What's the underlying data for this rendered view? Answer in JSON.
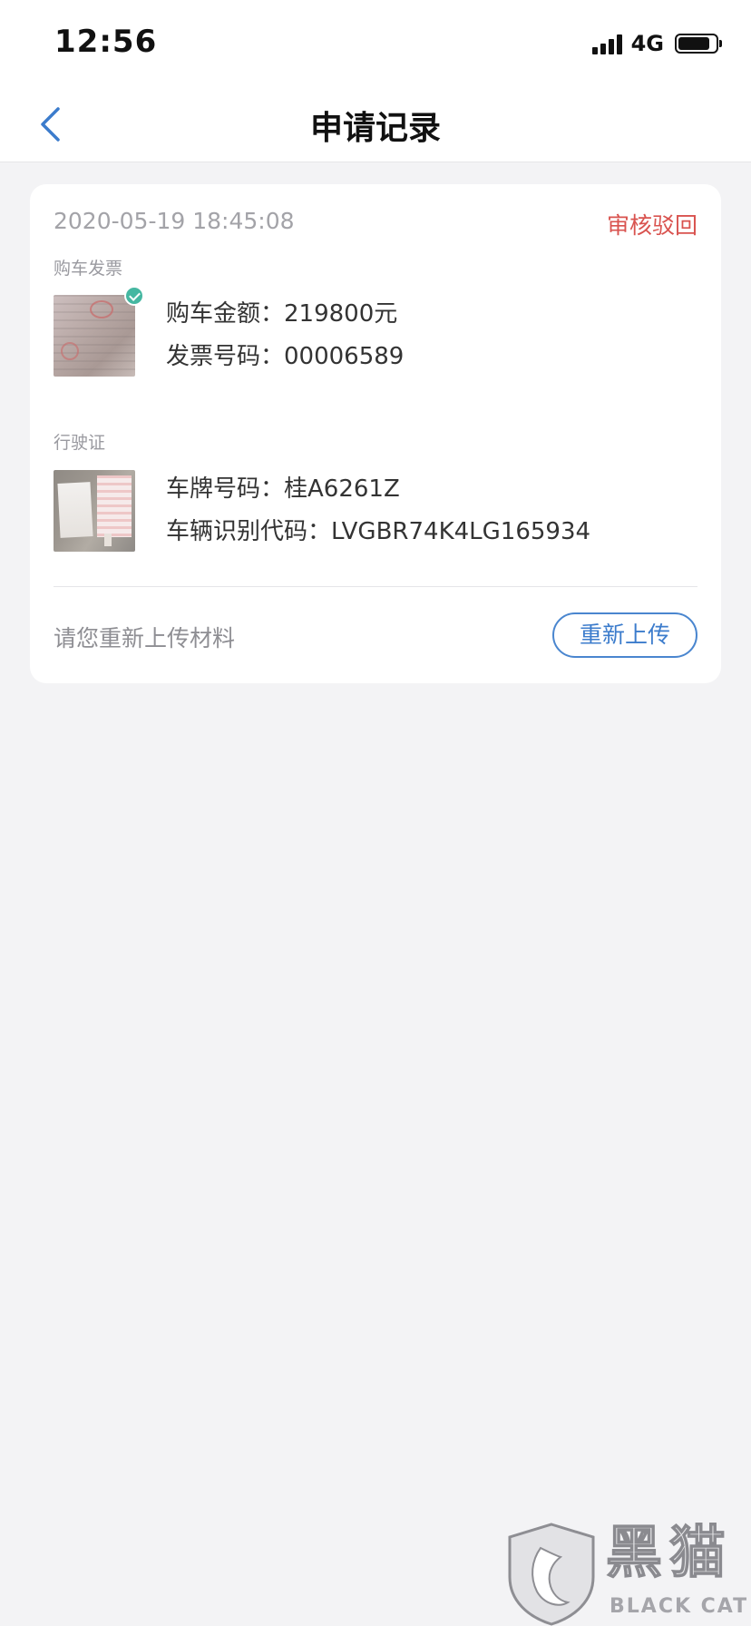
{
  "status_bar": {
    "time": "12:56",
    "network": "4G"
  },
  "nav": {
    "title": "申请记录",
    "back_icon": "chevron-left-icon",
    "accent_color": "#3c7ccc"
  },
  "record": {
    "datetime": "2020-05-19 18:45:08",
    "status": "审核驳回",
    "status_color": "#d9534f",
    "invoice": {
      "section_label": "购车发票",
      "thumbnail": "invoice-photo",
      "verified": true,
      "amount_label": "购车金额：",
      "amount_value": "219800元",
      "number_label": "发票号码：",
      "number_value": "00006589"
    },
    "license": {
      "section_label": "行驶证",
      "thumbnail": "license-photo",
      "plate_label": "车牌号码：",
      "plate_value": "桂A6261Z",
      "vin_label": "车辆识别代码：",
      "vin_value": "LVGBR74K4LG165934"
    },
    "hint": "请您重新上传材料",
    "reupload_label": "重新上传"
  },
  "watermark": {
    "title": "黑猫",
    "subtitle": "BLACK CAT"
  }
}
